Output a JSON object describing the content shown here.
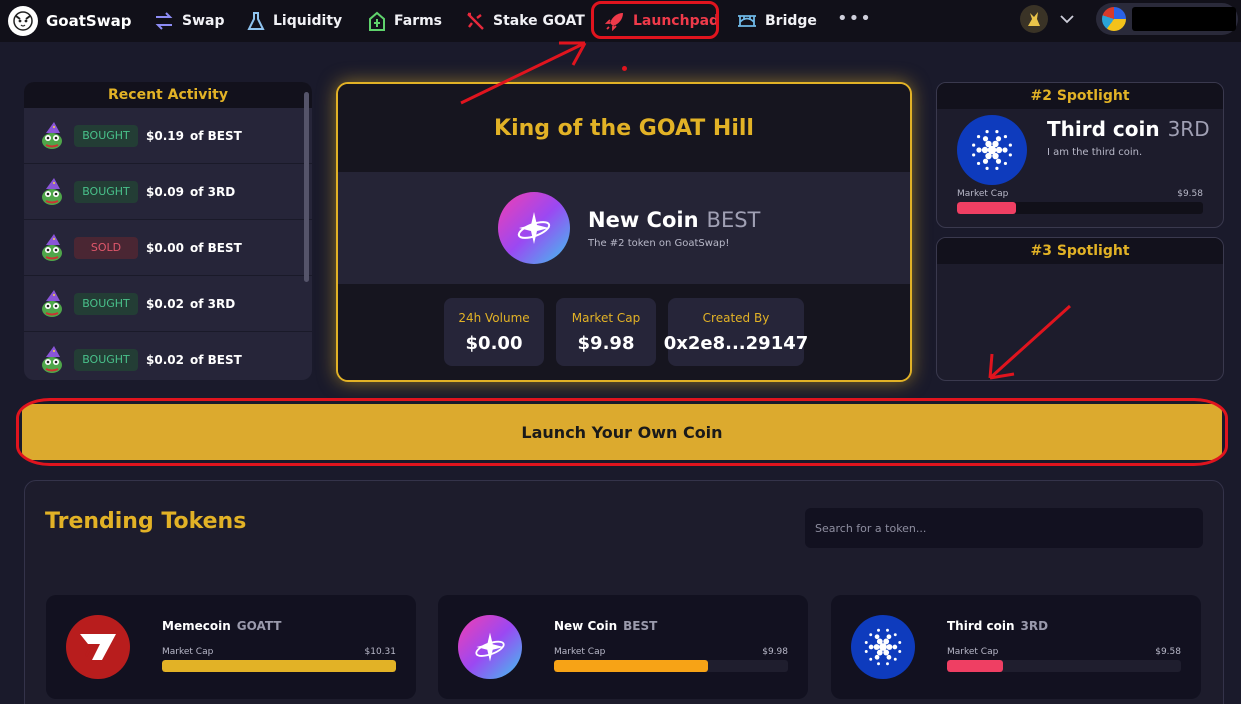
{
  "nav": {
    "brand": "GoatSwap",
    "items": [
      {
        "label": "Swap",
        "icon": "swap-icon"
      },
      {
        "label": "Liquidity",
        "icon": "flask-icon"
      },
      {
        "label": "Farms",
        "icon": "farm-icon"
      },
      {
        "label": "Stake GOAT",
        "icon": "stake-icon"
      },
      {
        "label": "Launchpad",
        "icon": "rocket-icon",
        "active": true
      },
      {
        "label": "Bridge",
        "icon": "bridge-icon"
      }
    ],
    "more": "•••"
  },
  "recent_activity": {
    "title": "Recent Activity",
    "rows": [
      {
        "action": "BOUGHT",
        "amount": "$0.19",
        "of": "of BEST"
      },
      {
        "action": "BOUGHT",
        "amount": "$0.09",
        "of": "of 3RD"
      },
      {
        "action": "SOLD",
        "amount": "$0.00",
        "of": "of BEST"
      },
      {
        "action": "BOUGHT",
        "amount": "$0.02",
        "of": "of 3RD"
      },
      {
        "action": "BOUGHT",
        "amount": "$0.02",
        "of": "of BEST"
      }
    ]
  },
  "king": {
    "title": "King of the GOAT Hill",
    "name": "New Coin",
    "symbol": "BEST",
    "description": "The #2 token on GoatSwap!",
    "stats": [
      {
        "label": "24h Volume",
        "value": "$0.00"
      },
      {
        "label": "Market Cap",
        "value": "$9.98"
      },
      {
        "label": "Created By",
        "value": "0x2e8...29147"
      }
    ]
  },
  "spotlight2": {
    "title": "#2 Spotlight",
    "name": "Third coin",
    "symbol": "3RD",
    "description": "I am the third coin.",
    "mc_label": "Market Cap",
    "mc_value": "$9.58",
    "mc_fraction": 0.24
  },
  "spotlight3": {
    "title": "#3 Spotlight"
  },
  "launch_button": "Launch Your Own Coin",
  "trending": {
    "title": "Trending Tokens",
    "search_placeholder": "Search for a token...",
    "tokens": [
      {
        "name": "Memecoin",
        "symbol": "GOATT",
        "mc_label": "Market Cap",
        "mc_value": "$10.31",
        "mc_fraction": 1.0,
        "color": "#e2b226"
      },
      {
        "name": "New Coin",
        "symbol": "BEST",
        "mc_label": "Market Cap",
        "mc_value": "$9.98",
        "mc_fraction": 0.66,
        "color": "#f7a316"
      },
      {
        "name": "Third coin",
        "symbol": "3RD",
        "mc_label": "Market Cap",
        "mc_value": "$9.58",
        "mc_fraction": 0.24,
        "color": "#ef3f63"
      }
    ]
  },
  "colors": {
    "accent": "#e2b226",
    "annotation": "#e0141e",
    "bought": "#49c08a",
    "sold": "#e0576b"
  }
}
